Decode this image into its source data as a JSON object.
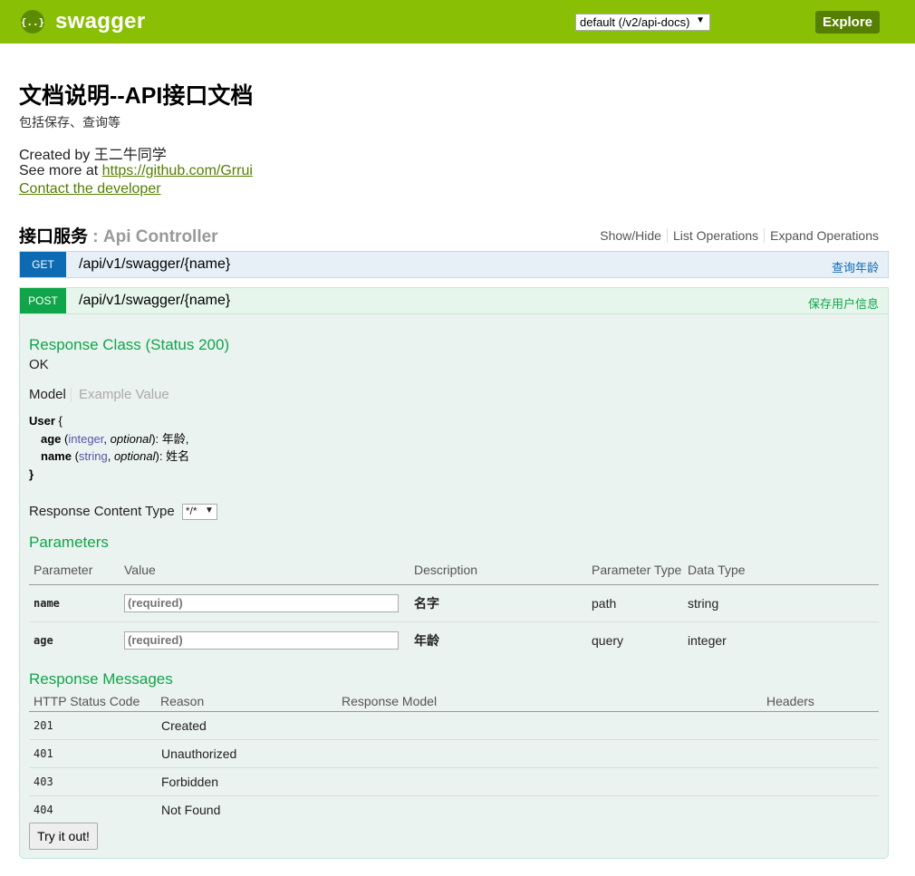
{
  "header": {
    "logo_glyph": "{..}",
    "logo_text": "swagger",
    "spec_selected": "default (/v2/api-docs)",
    "explore_label": "Explore",
    "brand_color": "#89bf04"
  },
  "info": {
    "title": "文档说明--API接口文档",
    "description": "包括保存、查询等",
    "created_by": "Created by 王二牛同学",
    "see_more_prefix": "See more at ",
    "see_more_link": "https://github.com/Grrui",
    "contact": "Contact the developer"
  },
  "resource": {
    "name": "接口服务",
    "separator": " : ",
    "controller": "Api Controller",
    "ops": [
      "Show/Hide",
      "List Operations",
      "Expand Operations"
    ]
  },
  "operations": {
    "get": {
      "method": "GET",
      "path": "/api/v1/swagger/{name}",
      "summary": "查询年龄"
    },
    "post": {
      "method": "POST",
      "path": "/api/v1/swagger/{name}",
      "summary": "保存用户信息",
      "response_class_title": "Response Class (Status 200)",
      "response_class_value": "OK",
      "tab_model": "Model",
      "tab_example": "Example Value",
      "model": {
        "name": "User",
        "open": "{",
        "close": "}",
        "fields": [
          {
            "name": "age",
            "type": "integer",
            "optional": "optional",
            "desc": "年龄,"
          },
          {
            "name": "name",
            "type": "string",
            "optional": "optional",
            "desc": "姓名"
          }
        ]
      },
      "content_type_label": "Response Content Type",
      "content_type_value": "*/*",
      "parameters_title": "Parameters",
      "param_headers": [
        "Parameter",
        "Value",
        "Description",
        "Parameter Type",
        "Data Type"
      ],
      "params": [
        {
          "name": "name",
          "placeholder": "(required)",
          "desc": "名字",
          "ptype": "path",
          "dtype": "string"
        },
        {
          "name": "age",
          "placeholder": "(required)",
          "desc": "年龄",
          "ptype": "query",
          "dtype": "integer"
        }
      ],
      "messages_title": "Response Messages",
      "msg_headers": [
        "HTTP Status Code",
        "Reason",
        "Response Model",
        "Headers"
      ],
      "messages": [
        {
          "code": "201",
          "reason": "Created"
        },
        {
          "code": "401",
          "reason": "Unauthorized"
        },
        {
          "code": "403",
          "reason": "Forbidden"
        },
        {
          "code": "404",
          "reason": "Not Found"
        }
      ],
      "try_label": "Try it out!"
    }
  }
}
